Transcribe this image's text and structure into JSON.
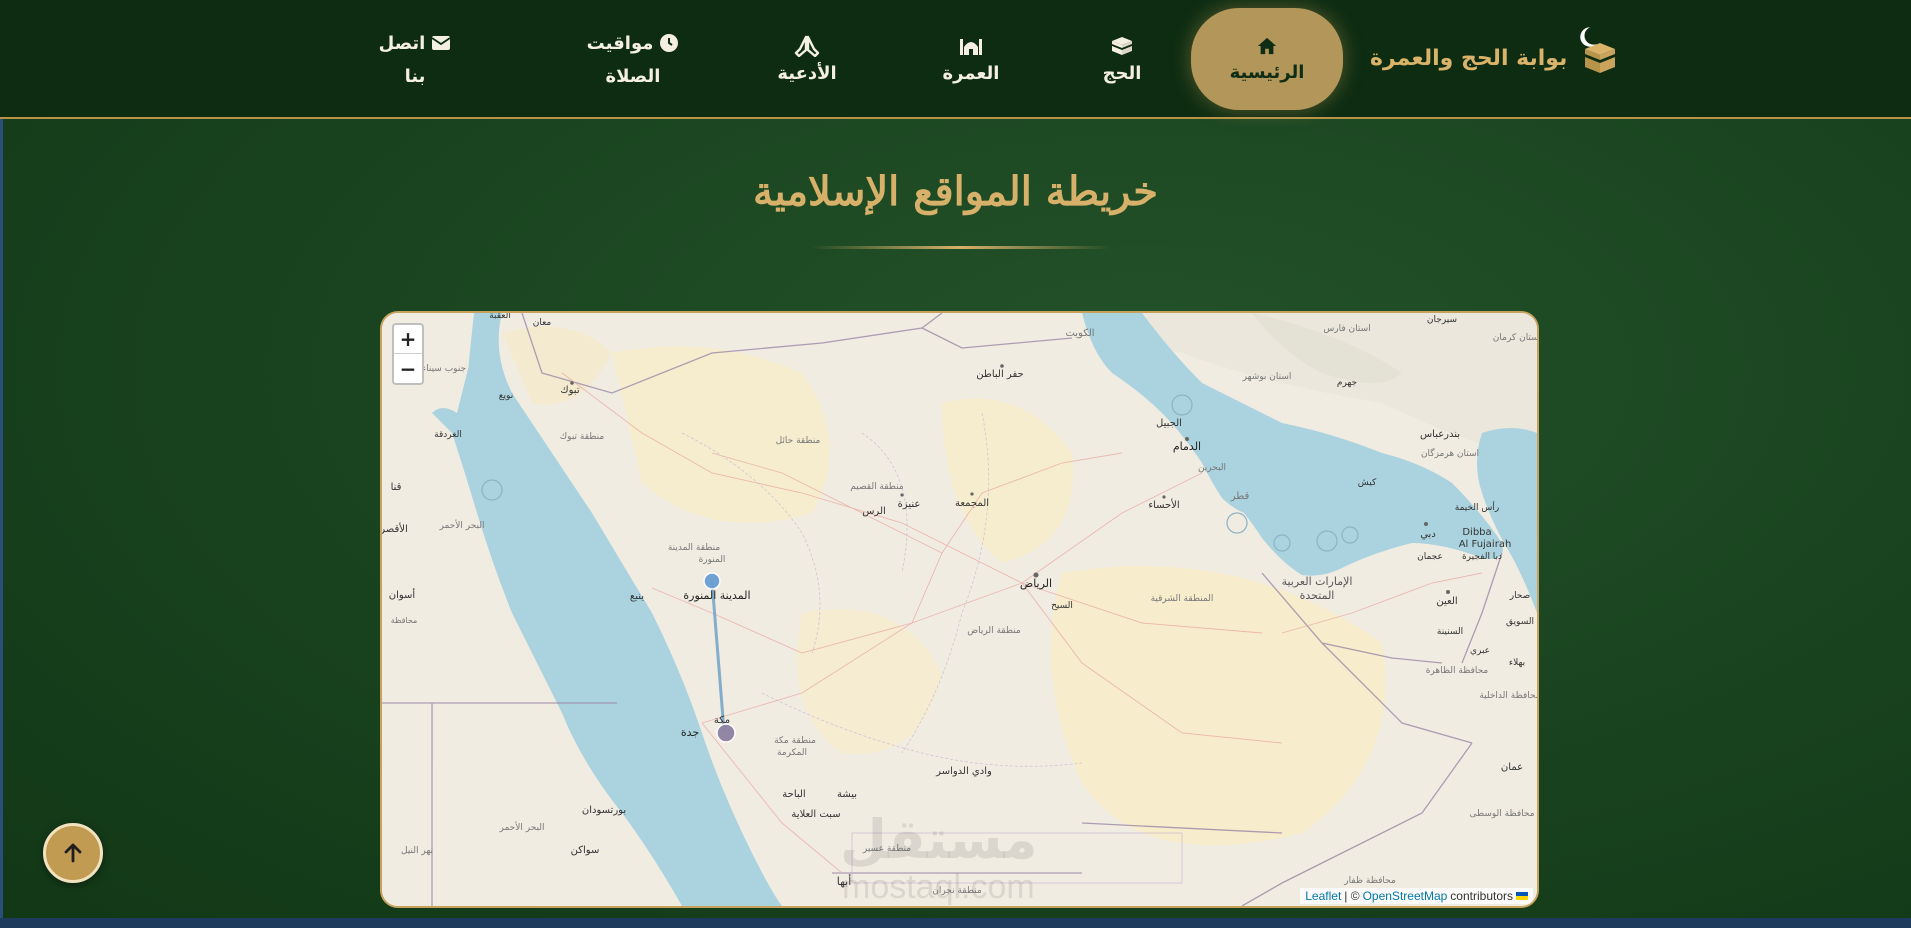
{
  "brand": {
    "title": "بوابة الحج والعمرة",
    "icon": "kaaba-icon"
  },
  "theme_toggle": {
    "icon": "moon-icon"
  },
  "nav": {
    "items": [
      {
        "label": "الرئيسية",
        "icon": "home-icon",
        "active": true
      },
      {
        "label": "الحج",
        "icon": "kaaba-icon"
      },
      {
        "label": "العمرة",
        "icon": "mosque-icon"
      },
      {
        "label": "الأدعية",
        "icon": "praying-hands-icon"
      },
      {
        "label": "مواقيت الصلاة",
        "line1": "مواقيت",
        "line2": "الصلاة",
        "icon": "clock-icon"
      },
      {
        "label": "اتصل بنا",
        "line1": "اتصل",
        "line2": "بنا",
        "icon": "envelope-icon"
      }
    ]
  },
  "page": {
    "title": "خريطة المواقع الإسلامية"
  },
  "map": {
    "zoom_in": "+",
    "zoom_out": "−",
    "attribution": {
      "leaflet": "Leaflet",
      "sep": "| ©",
      "osm": "OpenStreetMap",
      "suffix": "contributors"
    },
    "labels": {
      "madinah": "المدينة المنورة",
      "makkah": "مكة",
      "jeddah": "جدة",
      "riyadh": "الرياض",
      "dammam": "الدمام",
      "kuwait": "الكويت",
      "tabuk": "تبوك",
      "yanbu": "ينبع",
      "hail": "منطقة حائل",
      "qassim": "منطقة القصيم",
      "unaizah": "عنيزة",
      "rass": "الرس",
      "majmaah": "المجمعة",
      "hafr": "حفر الباطن",
      "jubail": "الجبيل",
      "bahrain": "البحرين",
      "qatar": "قطر",
      "ahsa": "الأحساء",
      "uae": "الإمارات العربية",
      "uae2": "المتحدة",
      "dubai": "دبي",
      "dibba": "Dibba",
      "fujairah": "Al Fujairah",
      "fujairah_ar": "دبا الفجيرة",
      "eastern": "المنطقة الشرقية",
      "riyadh_region": "منطقة الرياض",
      "kharj": "السيح",
      "makkah_region": "منطقة مكة",
      "makkah_region2": "المكرمة",
      "dawasir": "وادي الدواسر",
      "baha": "الباحة",
      "bisha": "بيشة",
      "abha": "أبها",
      "qilwah": "سبت العلاية",
      "port_sudan": "بورتسودان",
      "suakin": "سواكن",
      "red_sea": "البحر الأحمر",
      "red_sea2": "البحر الأحمر",
      "aswan": "أسوان",
      "qena": "قنا",
      "luxor": "الأقصر",
      "hurghada": "الغردقة",
      "sinai": "جنوب سيناء",
      "nuweiba": "نويع",
      "aqaba": "العقبة",
      "maan": "معان",
      "fars": "استان فارس",
      "bushehr": "استان بوشهر",
      "jahrom": "جهرم",
      "sirjan": "سيرجان",
      "kerman": "استان كرمان",
      "bandar_abbas": "بندرعباس",
      "hormozgan": "استان هرمزگان",
      "kish": "کیش",
      "rak": "رأس الخيمة",
      "ajman": "عجمان",
      "ain": "العين",
      "suwaiq": "السويق",
      "sohar": "صحار",
      "sunaynah": "السنينة",
      "ibri": "عبري",
      "bahla": "بهلاء",
      "dhahirah": "محافظة الظاهرة",
      "dakhiliyah": "محافظة الداخلية",
      "oman": "عمان",
      "wusta": "محافظة الوسطى",
      "dhofar": "محافظة ظفار",
      "najran": "منطقة نجران",
      "asir": "منطقة عسير",
      "madinah_region": "منطقة المدينة",
      "madinah_region2": "المنورة",
      "tabuk_region": "منطقة تبوك",
      "nile": "نهر النيل",
      "mahajah": "محافظة"
    }
  },
  "watermark": {
    "text": "مستقل",
    "sub": "mostaql.com"
  },
  "scroll_top": {
    "icon": "arrow-up-icon"
  }
}
